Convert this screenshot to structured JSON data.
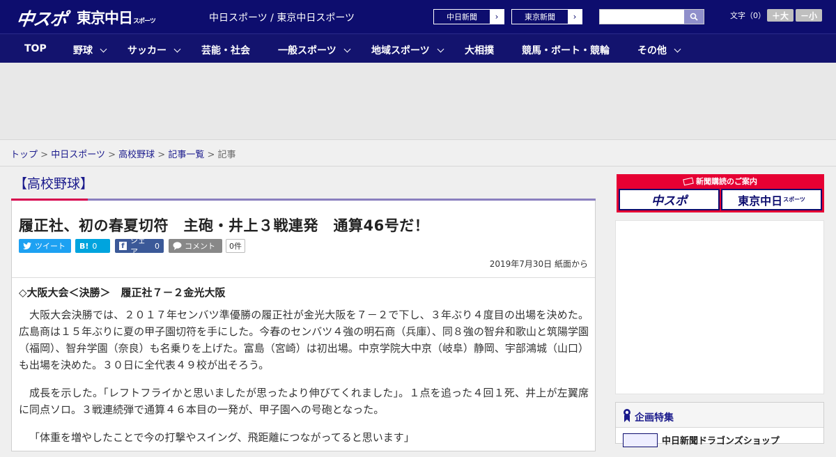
{
  "header": {
    "logo_chuspo": "中スポ",
    "logo_tokyo": "東京中日",
    "logo_tokyo_sub": "スポーツ",
    "site_links": "中日スポーツ / 東京中日スポーツ",
    "paper_buttons": [
      {
        "label": "中日新聞",
        "arrow": "›"
      },
      {
        "label": "東京新聞",
        "arrow": "›"
      }
    ],
    "search": {
      "placeholder": "",
      "value": "",
      "icon": "search-icon"
    },
    "font_size": {
      "label": "文字（0）",
      "bigger": "＋大",
      "smaller": "－小"
    }
  },
  "nav": {
    "items": [
      {
        "label": "TOP",
        "has_submenu": false
      },
      {
        "label": "野球",
        "has_submenu": true
      },
      {
        "label": "サッカー",
        "has_submenu": true
      },
      {
        "label": "芸能・社会",
        "has_submenu": false
      },
      {
        "label": "一般スポーツ",
        "has_submenu": true
      },
      {
        "label": "地域スポーツ",
        "has_submenu": true
      },
      {
        "label": "大相撲",
        "has_submenu": false
      },
      {
        "label": "競馬・ボート・競輪",
        "has_submenu": false
      },
      {
        "label": "その他",
        "has_submenu": true
      }
    ]
  },
  "breadcrumb": {
    "items": [
      "トップ",
      "中日スポーツ",
      "高校野球",
      "記事一覧"
    ],
    "separator": ">",
    "current": "記事"
  },
  "category": {
    "title": "【高校野球】"
  },
  "article": {
    "headline": "履正社、初の春夏切符　主砲・井上３戦連発　通算46号だ！",
    "share": {
      "tweet": "ツイート",
      "hatena_icon": "B!",
      "hatena_count": "0",
      "facebook": "シェア",
      "facebook_count": "0",
      "comment": "コメント",
      "comment_count": "0件"
    },
    "date": "2019年7月30日 紙面から",
    "subhead": "◇大阪大会＜決勝＞　履正社７－２金光大阪",
    "paragraphs": [
      "大阪大会決勝では、２０１７年センバツ準優勝の履正社が金光大阪を７－２で下し、３年ぶり４度目の出場を決めた。広島商は１５年ぶりに夏の甲子園切符を手にした。今春のセンバツ４強の明石商（兵庫）、同８強の智弁和歌山と筑陽学園（福岡）、智弁学園（奈良）も名乗りを上げた。富島（宮崎）は初出場。中京学院大中京（岐阜）静岡、宇部鴻城（山口）も出場を決めた。３０日に全代表４９校が出そろう。",
      "成長を示した。「レフトフライかと思いましたが思ったより伸びてくれました」。１点を追った４回１死、井上が左翼席に同点ソロ。３戦連続弾で通算４６本目の一発が、甲子園への号砲となった。",
      "「体重を増やしたことで今の打撃やスイング、飛距離につながってると思います」"
    ]
  },
  "sidebar": {
    "subscribe": {
      "title": "新聞購読のご案内",
      "btn_chuspo": "中スポ",
      "btn_tokyo": "東京中日",
      "btn_tokyo_sub": "スポーツ"
    },
    "feature": {
      "title": "企画特集",
      "item": "中日新聞ドラゴンズショップ"
    }
  },
  "colors": {
    "brand_navy": "#0d0d6e",
    "accent_red": "#e60033",
    "twitter": "#1da1f2",
    "hatena": "#00a4de",
    "facebook": "#3b5998",
    "comment": "#888888"
  }
}
